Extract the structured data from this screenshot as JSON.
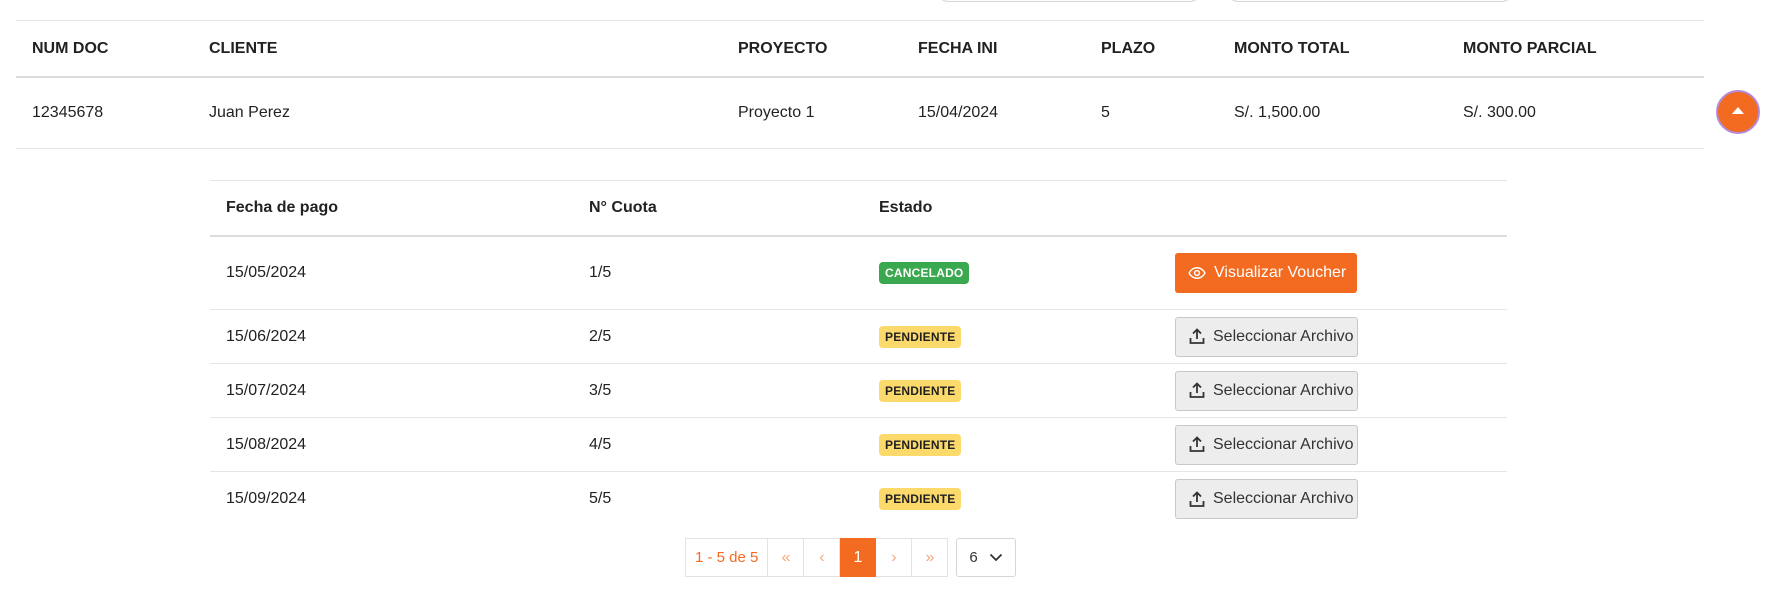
{
  "main_table": {
    "headers": [
      "NUM DOC",
      "CLIENTE",
      "PROYECTO",
      "FECHA INI",
      "PLAZO",
      "MONTO TOTAL",
      "MONTO PARCIAL"
    ],
    "row": {
      "num_doc": "12345678",
      "cliente": "Juan Perez",
      "proyecto": "Proyecto 1",
      "fecha_ini": "15/04/2024",
      "plazo": "5",
      "monto_total": "S/. 1,500.00",
      "monto_parcial": "S/. 300.00"
    }
  },
  "installments": {
    "headers": [
      "Fecha de pago",
      "N° Cuota",
      "Estado"
    ],
    "rows": [
      {
        "fecha": "15/05/2024",
        "cuota": "1/5",
        "estado": "CANCELADO",
        "action": "Visualizar Voucher"
      },
      {
        "fecha": "15/06/2024",
        "cuota": "2/5",
        "estado": "PENDIENTE",
        "action": "Seleccionar Archivo"
      },
      {
        "fecha": "15/07/2024",
        "cuota": "3/5",
        "estado": "PENDIENTE",
        "action": "Seleccionar Archivo"
      },
      {
        "fecha": "15/08/2024",
        "cuota": "4/5",
        "estado": "PENDIENTE",
        "action": "Seleccionar Archivo"
      },
      {
        "fecha": "15/09/2024",
        "cuota": "5/5",
        "estado": "PENDIENTE",
        "action": "Seleccionar Archivo"
      }
    ]
  },
  "pagination": {
    "info": "1 - 5 de 5",
    "first": "«",
    "prev": "‹",
    "current": "1",
    "next": "›",
    "last": "»",
    "page_size": "6"
  },
  "colors": {
    "accent": "#f26b21",
    "cancelado": "#3aa84e",
    "pendiente": "#fbd96b"
  },
  "icons": {
    "expand": "caret-up-icon",
    "voucher": "eye-icon",
    "upload": "upload-icon",
    "page_size": "chevron-down-icon"
  }
}
